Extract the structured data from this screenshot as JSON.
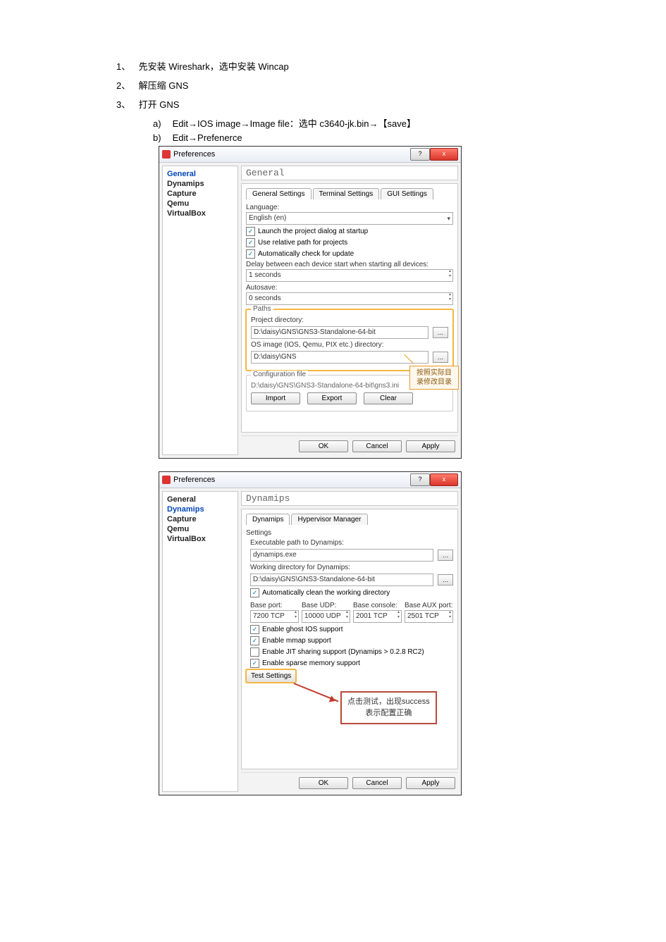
{
  "steps": {
    "s1_num": "1、",
    "s1_text": "先安装 Wireshark，选中安装 Wincap",
    "s2_num": "2、",
    "s2_text": "解压缩 GNS",
    "s3_num": "3、",
    "s3_text": "打开 GNS",
    "a_letter": "a)",
    "a_text": "Edit→IOS image→Image file：选中 c3640-jk.bin→【save】",
    "b_letter": "b)",
    "b_text": "Edit→Prefenerce"
  },
  "win1": {
    "title": "Preferences",
    "help_btn": "?",
    "close_btn": "x",
    "side": [
      "General",
      "Dynamips",
      "Capture",
      "Qemu",
      "VirtualBox"
    ],
    "side_sel": 0,
    "header": "General",
    "tabs": [
      "General Settings",
      "Terminal Settings",
      "GUI Settings"
    ],
    "active_tab": 0,
    "lang_label": "Language:",
    "lang_value": "English (en)",
    "chk_launch": "Launch the project dialog at startup",
    "chk_relative": "Use relative path for projects",
    "chk_update": "Automatically check for update",
    "delay_label": "Delay between each device start when starting all devices:",
    "delay_value": "1 seconds",
    "autosave_label": "Autosave:",
    "autosave_value": "0 seconds",
    "paths_title": "Paths",
    "projdir_label": "Project directory:",
    "projdir_value": "D:\\daisy\\GNS\\GNS3-Standalone-64-bit",
    "osimg_label": "OS image (IOS, Qemu, PIX etc.) directory:",
    "osimg_value": "D:\\daisy\\GNS",
    "cfg_title": "Configuration file",
    "cfg_value": "D:\\daisy\\GNS\\GNS3-Standalone-64-bit\\gns3.ini",
    "import_btn": "Import",
    "export_btn": "Export",
    "clear_btn": "Clear",
    "callout_text": "按照实际目\n录修改目录",
    "ok": "OK",
    "cancel": "Cancel",
    "apply": "Apply"
  },
  "win2": {
    "title": "Preferences",
    "help_btn": "?",
    "close_btn": "x",
    "side": [
      "General",
      "Dynamips",
      "Capture",
      "Qemu",
      "VirtualBox"
    ],
    "side_sel": 1,
    "header": "Dynamips",
    "tabs": [
      "Dynamips",
      "Hypervisor Manager"
    ],
    "active_tab": 0,
    "settings_title": "Settings",
    "exec_label": "Executable path to Dynamips:",
    "exec_value": "dynamips.exe",
    "workdir_label": "Working directory for Dynamips:",
    "workdir_value": "D:\\daisy\\GNS\\GNS3-Standalone-64-bit",
    "chk_clean": "Automatically clean the working directory",
    "base_port": "Base port:",
    "base_udp": "Base UDP:",
    "base_console": "Base console:",
    "base_aux": "Base AUX port:",
    "val_port": "7200 TCP",
    "val_udp": "10000 UDP",
    "val_console": "2001 TCP",
    "val_aux": "2501 TCP",
    "chk_ghost": "Enable ghost IOS support",
    "chk_mmap": "Enable mmap support",
    "chk_jit": "Enable JIT sharing support (Dynamips > 0.2.8 RC2)",
    "chk_sparse": "Enable sparse memory support",
    "test_btn": "Test Settings",
    "note_text": "点击测试，出现success\n表示配置正确",
    "ok": "OK",
    "cancel": "Cancel",
    "apply": "Apply"
  }
}
